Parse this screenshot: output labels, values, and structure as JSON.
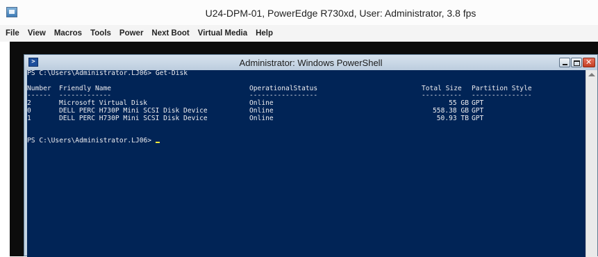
{
  "outer_window": {
    "title": "U24-DPM-01, PowerEdge R730xd, User: Administrator, 3.8 fps",
    "icon": "kvm-app-icon"
  },
  "menubar": {
    "items": [
      "File",
      "View",
      "Macros",
      "Tools",
      "Power",
      "Next Boot",
      "Virtual Media",
      "Help"
    ]
  },
  "ps_window": {
    "title": "Administrator: Windows PowerShell",
    "icon": "powershell-icon"
  },
  "console": {
    "command_line": "PS C:\\Users\\Administrator.LJ06> Get-Disk",
    "headers": {
      "number": "Number",
      "friendly_name": "Friendly Name",
      "operational_status": "OperationalStatus",
      "total_size": "Total Size",
      "partition_style": "Partition Style"
    },
    "separators": {
      "number": "------",
      "friendly_name": "-------------",
      "operational_status": "-----------------",
      "total_size": "----------",
      "partition_style": "---------------"
    },
    "rows": [
      {
        "number": "2",
        "friendly_name": "Microsoft Virtual Disk",
        "operational_status": "Online",
        "total_size": "55 GB",
        "partition_style": "GPT"
      },
      {
        "number": "0",
        "friendly_name": "DELL PERC H730P Mini SCSI Disk Device",
        "operational_status": "Online",
        "total_size": "558.38 GB",
        "partition_style": "GPT"
      },
      {
        "number": "1",
        "friendly_name": "DELL PERC H730P Mini SCSI Disk Device",
        "operational_status": "Online",
        "total_size": "50.93 TB",
        "partition_style": "GPT"
      }
    ],
    "prompt": "PS C:\\Users\\Administrator.LJ06> "
  }
}
